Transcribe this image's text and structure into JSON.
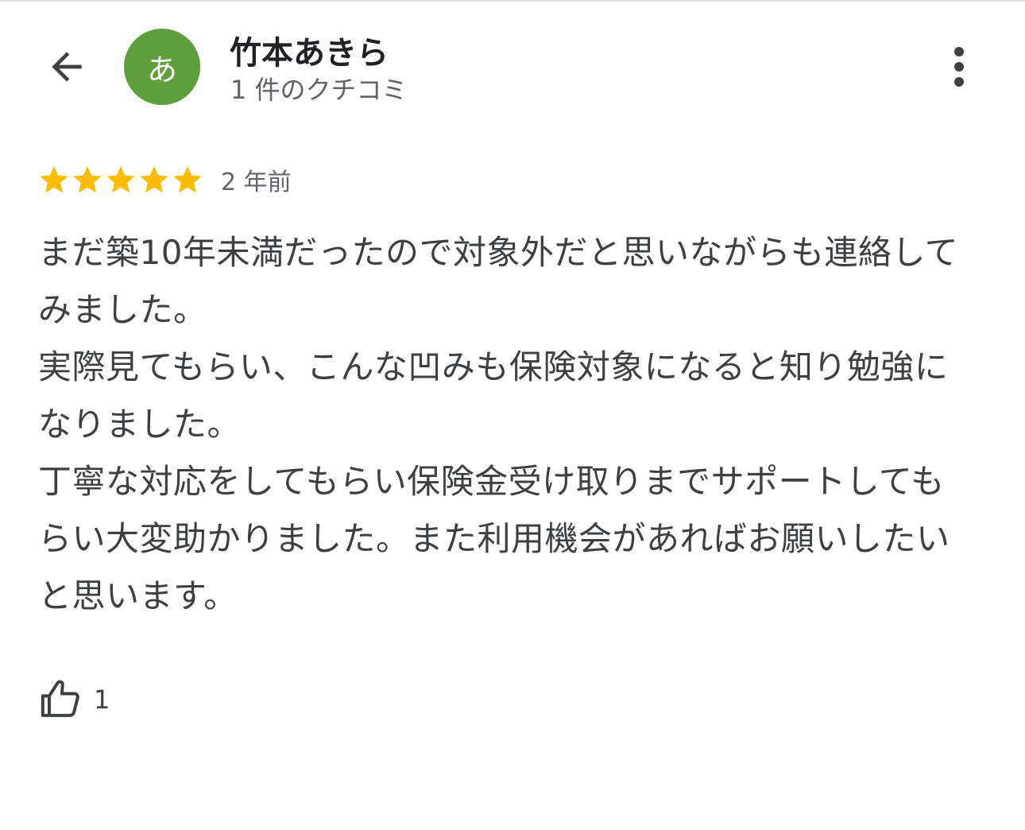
{
  "header": {
    "back_icon": "arrow-back-icon",
    "avatar_letter": "あ",
    "avatar_color": "#5f9f3b",
    "author_name": "竹本あきら",
    "review_count": "1 件のクチコミ",
    "more_icon": "more-vert-icon"
  },
  "review": {
    "rating": 5,
    "max_rating": 5,
    "star_color": "#fbbc04",
    "date": "2 年前",
    "text": "まだ築10年未満だったので対象外だと思いながらも連絡してみました。\n実際見てもらい、こんな凹みも保険対象になると知り勉強になりました。\n丁寧な対応をしてもらい保険金受け取りまでサポートしてもらい大変助かりました。また利用機会があればお願いしたいと思います。"
  },
  "actions": {
    "like_icon": "thumb-up-icon",
    "like_count": "1"
  }
}
